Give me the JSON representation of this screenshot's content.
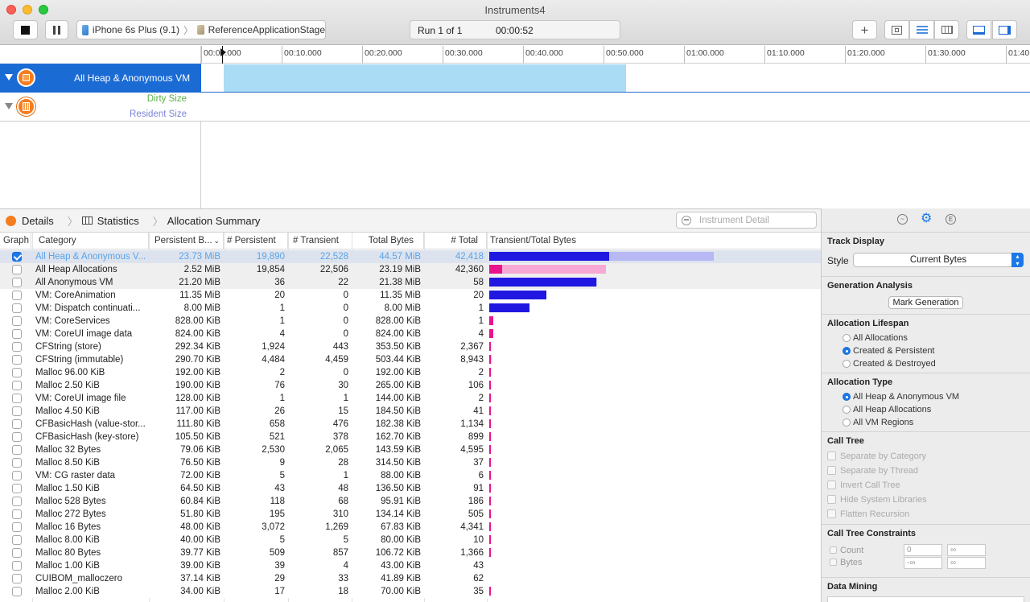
{
  "window": {
    "title": "Instruments4"
  },
  "toolbar": {
    "device": "iPhone 6s Plus (9.1)",
    "target": "ReferenceApplicationStage",
    "run_label": "Run 1 of 1",
    "elapsed": "00:00:52"
  },
  "timeline": {
    "ticks": [
      "00:00.000",
      "00:10.000",
      "00:20.000",
      "00:30.000",
      "00:40.000",
      "00:50.000",
      "01:00.000",
      "01:10.000",
      "01:20.000",
      "01:30.000",
      "01:40"
    ]
  },
  "tracks": {
    "heap": "All Heap & Anonymous VM",
    "dirty": "Dirty Size",
    "resident": "Resident Size"
  },
  "jumpbar": {
    "details": "Details",
    "statistics": "Statistics",
    "summary": "Allocation Summary",
    "search_placeholder": "Instrument Detail"
  },
  "table": {
    "headers": [
      "Graph",
      "Category",
      "Persistent B...",
      "# Persistent",
      "# Transient",
      "Total Bytes",
      "# Total",
      "Transient/Total Bytes"
    ],
    "rows": [
      {
        "checked": true,
        "category": "All Heap & Anonymous V...",
        "persistent_bytes": "23.73 MiB",
        "persistent": "19,890",
        "transient": "22,528",
        "total_bytes": "44.57 MiB",
        "total": "42,418",
        "persistent_mib": 23.73,
        "total_mib": 44.57
      },
      {
        "checked": false,
        "category": "All Heap Allocations",
        "persistent_bytes": "2.52 MiB",
        "persistent": "19,854",
        "transient": "22,506",
        "total_bytes": "23.19 MiB",
        "total": "42,360",
        "persistent_mib": 2.52,
        "total_mib": 23.19
      },
      {
        "checked": false,
        "category": "All Anonymous VM",
        "persistent_bytes": "21.20 MiB",
        "persistent": "36",
        "transient": "22",
        "total_bytes": "21.38 MiB",
        "total": "58",
        "persistent_mib": 21.2,
        "total_mib": 21.38
      },
      {
        "checked": false,
        "category": "VM: CoreAnimation",
        "persistent_bytes": "11.35 MiB",
        "persistent": "20",
        "transient": "0",
        "total_bytes": "11.35 MiB",
        "total": "20",
        "persistent_mib": 11.35,
        "total_mib": 11.35
      },
      {
        "checked": false,
        "category": "VM: Dispatch continuati...",
        "persistent_bytes": "8.00 MiB",
        "persistent": "1",
        "transient": "0",
        "total_bytes": "8.00 MiB",
        "total": "1",
        "persistent_mib": 8.0,
        "total_mib": 8.0
      },
      {
        "checked": false,
        "category": "VM: CoreServices",
        "persistent_bytes": "828.00 KiB",
        "persistent": "1",
        "transient": "0",
        "total_bytes": "828.00 KiB",
        "total": "1",
        "persistent_mib": 0.809,
        "total_mib": 0.809
      },
      {
        "checked": false,
        "category": "VM: CoreUI image data",
        "persistent_bytes": "824.00 KiB",
        "persistent": "4",
        "transient": "0",
        "total_bytes": "824.00 KiB",
        "total": "4",
        "persistent_mib": 0.805,
        "total_mib": 0.805
      },
      {
        "checked": false,
        "category": "CFString (store)",
        "persistent_bytes": "292.34 KiB",
        "persistent": "1,924",
        "transient": "443",
        "total_bytes": "353.50 KiB",
        "total": "2,367",
        "persistent_mib": 0.285,
        "total_mib": 0.345
      },
      {
        "checked": false,
        "category": "CFString (immutable)",
        "persistent_bytes": "290.70 KiB",
        "persistent": "4,484",
        "transient": "4,459",
        "total_bytes": "503.44 KiB",
        "total": "8,943",
        "persistent_mib": 0.284,
        "total_mib": 0.492
      },
      {
        "checked": false,
        "category": "Malloc 96.00 KiB",
        "persistent_bytes": "192.00 KiB",
        "persistent": "2",
        "transient": "0",
        "total_bytes": "192.00 KiB",
        "total": "2",
        "persistent_mib": 0.188,
        "total_mib": 0.188
      },
      {
        "checked": false,
        "category": "Malloc 2.50 KiB",
        "persistent_bytes": "190.00 KiB",
        "persistent": "76",
        "transient": "30",
        "total_bytes": "265.00 KiB",
        "total": "106",
        "persistent_mib": 0.186,
        "total_mib": 0.259
      },
      {
        "checked": false,
        "category": "VM: CoreUI image file",
        "persistent_bytes": "128.00 KiB",
        "persistent": "1",
        "transient": "1",
        "total_bytes": "144.00 KiB",
        "total": "2",
        "persistent_mib": 0.125,
        "total_mib": 0.141
      },
      {
        "checked": false,
        "category": "Malloc 4.50 KiB",
        "persistent_bytes": "117.00 KiB",
        "persistent": "26",
        "transient": "15",
        "total_bytes": "184.50 KiB",
        "total": "41",
        "persistent_mib": 0.114,
        "total_mib": 0.18
      },
      {
        "checked": false,
        "category": "CFBasicHash (value-stor...",
        "persistent_bytes": "111.80 KiB",
        "persistent": "658",
        "transient": "476",
        "total_bytes": "182.38 KiB",
        "total": "1,134",
        "persistent_mib": 0.109,
        "total_mib": 0.178
      },
      {
        "checked": false,
        "category": "CFBasicHash (key-store)",
        "persistent_bytes": "105.50 KiB",
        "persistent": "521",
        "transient": "378",
        "total_bytes": "162.70 KiB",
        "total": "899",
        "persistent_mib": 0.103,
        "total_mib": 0.159
      },
      {
        "checked": false,
        "category": "Malloc 32 Bytes",
        "persistent_bytes": "79.06 KiB",
        "persistent": "2,530",
        "transient": "2,065",
        "total_bytes": "143.59 KiB",
        "total": "4,595",
        "persistent_mib": 0.077,
        "total_mib": 0.14
      },
      {
        "checked": false,
        "category": "Malloc 8.50 KiB",
        "persistent_bytes": "76.50 KiB",
        "persistent": "9",
        "transient": "28",
        "total_bytes": "314.50 KiB",
        "total": "37",
        "persistent_mib": 0.075,
        "total_mib": 0.307
      },
      {
        "checked": false,
        "category": "VM: CG raster data",
        "persistent_bytes": "72.00 KiB",
        "persistent": "5",
        "transient": "1",
        "total_bytes": "88.00 KiB",
        "total": "6",
        "persistent_mib": 0.07,
        "total_mib": 0.086
      },
      {
        "checked": false,
        "category": "Malloc 1.50 KiB",
        "persistent_bytes": "64.50 KiB",
        "persistent": "43",
        "transient": "48",
        "total_bytes": "136.50 KiB",
        "total": "91",
        "persistent_mib": 0.063,
        "total_mib": 0.133
      },
      {
        "checked": false,
        "category": "Malloc 528 Bytes",
        "persistent_bytes": "60.84 KiB",
        "persistent": "118",
        "transient": "68",
        "total_bytes": "95.91 KiB",
        "total": "186",
        "persistent_mib": 0.059,
        "total_mib": 0.094
      },
      {
        "checked": false,
        "category": "Malloc 272 Bytes",
        "persistent_bytes": "51.80 KiB",
        "persistent": "195",
        "transient": "310",
        "total_bytes": "134.14 KiB",
        "total": "505",
        "persistent_mib": 0.051,
        "total_mib": 0.131
      },
      {
        "checked": false,
        "category": "Malloc 16 Bytes",
        "persistent_bytes": "48.00 KiB",
        "persistent": "3,072",
        "transient": "1,269",
        "total_bytes": "67.83 KiB",
        "total": "4,341",
        "persistent_mib": 0.047,
        "total_mib": 0.066
      },
      {
        "checked": false,
        "category": "Malloc 8.00 KiB",
        "persistent_bytes": "40.00 KiB",
        "persistent": "5",
        "transient": "5",
        "total_bytes": "80.00 KiB",
        "total": "10",
        "persistent_mib": 0.039,
        "total_mib": 0.078
      },
      {
        "checked": false,
        "category": "Malloc 80 Bytes",
        "persistent_bytes": "39.77 KiB",
        "persistent": "509",
        "transient": "857",
        "total_bytes": "106.72 KiB",
        "total": "1,366",
        "persistent_mib": 0.039,
        "total_mib": 0.104
      },
      {
        "checked": false,
        "category": "Malloc 1.00 KiB",
        "persistent_bytes": "39.00 KiB",
        "persistent": "39",
        "transient": "4",
        "total_bytes": "43.00 KiB",
        "total": "43",
        "persistent_mib": 0.038,
        "total_mib": 0.042
      },
      {
        "checked": false,
        "category": "CUIBOM_malloczero",
        "persistent_bytes": "37.14 KiB",
        "persistent": "29",
        "transient": "33",
        "total_bytes": "41.89 KiB",
        "total": "62",
        "persistent_mib": 0.036,
        "total_mib": 0.041
      },
      {
        "checked": false,
        "category": "Malloc 2.00 KiB",
        "persistent_bytes": "34.00 KiB",
        "persistent": "17",
        "transient": "18",
        "total_bytes": "70.00 KiB",
        "total": "35",
        "persistent_mib": 0.033,
        "total_mib": 0.068
      }
    ]
  },
  "inspector": {
    "track_display": "Track Display",
    "style_label": "Style",
    "style_value": "Current Bytes",
    "generation_analysis": "Generation Analysis",
    "mark_generation": "Mark Generation",
    "lifespan_title": "Allocation Lifespan",
    "lifespan_options": [
      "All Allocations",
      "Created & Persistent",
      "Created & Destroyed"
    ],
    "type_title": "Allocation Type",
    "type_options": [
      "All Heap & Anonymous VM",
      "All Heap Allocations",
      "All VM Regions"
    ],
    "call_tree_title": "Call Tree",
    "call_tree_options": [
      "Separate by Category",
      "Separate by Thread",
      "Invert Call Tree",
      "Hide System Libraries",
      "Flatten Recursion"
    ],
    "constraints_title": "Call Tree Constraints",
    "count_label": "Count",
    "bytes_label": "Bytes",
    "count_min": "0",
    "count_max": "∞",
    "bytes_min": "-∞",
    "bytes_max": "∞",
    "data_mining_title": "Data Mining"
  },
  "colors": {
    "accent": "#1b6bd5",
    "persistent_bar": "#2018e0",
    "transient_bar_bg": "#b8b8f4",
    "heap_bar": "#e8148c",
    "heap_bar_bg": "#f7a8d4",
    "track_fill": "#aadcf6"
  }
}
